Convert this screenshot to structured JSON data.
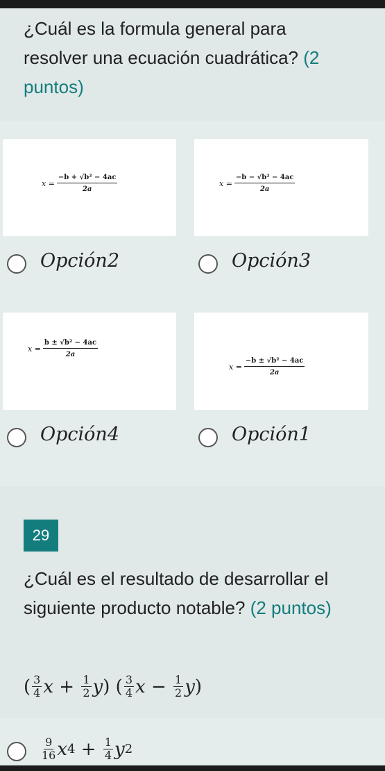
{
  "question1": {
    "text": "¿Cuál es la formula general para resolver una ecuación cuadrática?",
    "points": "(2 puntos)"
  },
  "options": [
    {
      "label": "Opción2",
      "formula_lhs": "x =",
      "formula_num": "−b + √b² − 4ac",
      "formula_den": "2a"
    },
    {
      "label": "Opción3",
      "formula_lhs": "x =",
      "formula_num": "−b − √b² − 4ac",
      "formula_den": "2a"
    },
    {
      "label": "Opción4",
      "formula_lhs": "x =",
      "formula_num": "b ± √b² − 4ac",
      "formula_den": "2a"
    },
    {
      "label": "Opción1",
      "formula_lhs": "x =",
      "formula_num": "−b ± √b² − 4ac",
      "formula_den": "2a"
    }
  ],
  "question2": {
    "number": "29",
    "text": "¿Cuál es el resultado de desarrollar el siguiente producto notable?",
    "points": "(2 puntos)",
    "expression": {
      "open1": "(",
      "f1n": "3",
      "f1d": "4",
      "v1": "x",
      "op1": "+",
      "f2n": "1",
      "f2d": "2",
      "v2": "y",
      "close1": ")",
      "open2": "(",
      "f3n": "3",
      "f3d": "4",
      "v3": "x",
      "op2": "−",
      "f4n": "1",
      "f4d": "2",
      "v4": "y",
      "close2": ")"
    },
    "first_answer": {
      "f1n": "9",
      "f1d": "16",
      "v1": "x",
      "e1": "4",
      "op": "+",
      "f2n": "1",
      "f2d": "4",
      "v2": "y",
      "e2": "2"
    }
  }
}
